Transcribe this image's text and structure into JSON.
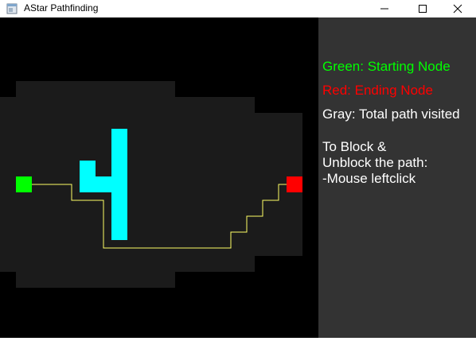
{
  "window": {
    "title": "AStar Pathfinding",
    "controls": {
      "minimize": "minimize-icon",
      "maximize": "maximize-icon",
      "close": "close-icon"
    }
  },
  "colors": {
    "background": "#000000",
    "visited": "#1b1b1b",
    "wall": "#00ffff",
    "start": "#00ff00",
    "end": "#ff0000",
    "path": "#ffff66",
    "panel": "#333333"
  },
  "legend": {
    "start": "Green: Starting Node",
    "end": "Red: Ending Node",
    "visited": "Gray: Total path visited"
  },
  "instructions": {
    "line1": "To Block &",
    "line2": "Unblock the path:",
    "line3": "-Mouse leftclick"
  }
}
